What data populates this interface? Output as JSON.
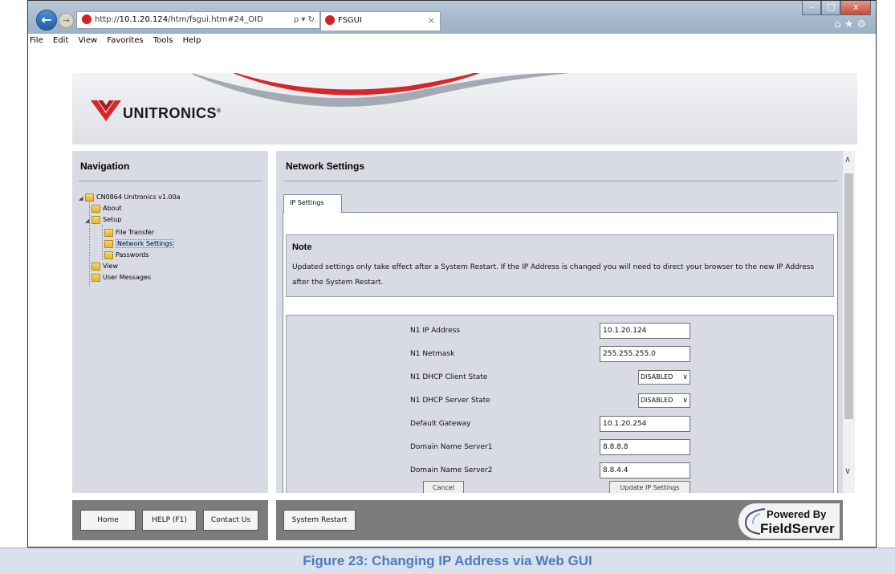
{
  "browser": {
    "url_prefix": "http://",
    "url_host": "10.1.20.124",
    "url_path": "/htm/fsgui.htm#24_OID",
    "address_tools": "ρ ▾ ↻",
    "tab_title": "FSGUI",
    "tab_close": "×",
    "window_minimize": "–",
    "window_maximize": "□",
    "window_close": "x",
    "toolbar_icons": "⌂★⚙",
    "menu": [
      "File",
      "Edit",
      "View",
      "Favorites",
      "Tools",
      "Help"
    ]
  },
  "header": {
    "brand": "UNITRONICS",
    "brand_mark": "®",
    "colors": {
      "swoosh_red": "#d6262a",
      "swoosh_gray": "#9aa1aa"
    }
  },
  "navigation": {
    "title": "Navigation",
    "tree": {
      "root": "CN0864 Unitronics v1.00a",
      "about": "About",
      "setup": "Setup",
      "file_transfer": "File Transfer",
      "network_settings": "Network Settings",
      "passwords": "Passwords",
      "view": "View",
      "user_messages": "User Messages"
    },
    "selected": "Network Settings"
  },
  "main": {
    "title": "Network Settings",
    "tab_label": "IP Settings",
    "note_title": "Note",
    "note_text": "Updated settings only take effect after a System Restart. If the IP Address is changed you will need to direct your browser to the new IP Address after the System Restart.",
    "fields": [
      {
        "label": "N1 IP Address",
        "value": "10.1.20.124"
      },
      {
        "label": "N1 Netmask",
        "value": "255.255.255.0"
      },
      {
        "label": "N1 DHCP Client State",
        "value": "DISABLED"
      },
      {
        "label": "N1 DHCP Server State",
        "value": "DISABLED"
      },
      {
        "label": "Default Gateway",
        "value": "10.1.20.254"
      },
      {
        "label": "Domain Name Server1",
        "value": "8.8.8.8"
      },
      {
        "label": "Domain Name Server2",
        "value": "8.8.4.4"
      }
    ],
    "cancel_label": "Cancel",
    "update_label": "Update IP Settings"
  },
  "footer": {
    "home": "Home",
    "help": "HELP (F1)",
    "contact": "Contact Us",
    "restart": "System Restart",
    "powered_by": "Powered By",
    "fieldserver": "FieldServer"
  },
  "caption": "Figure 23: Changing IP Address via Web GUI"
}
